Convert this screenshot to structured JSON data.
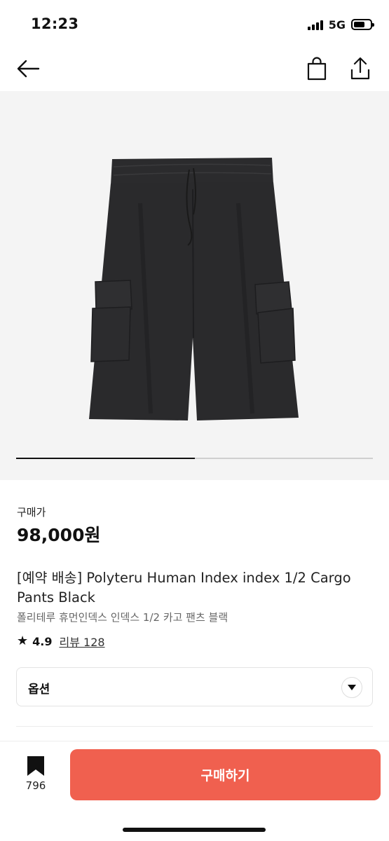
{
  "status_bar": {
    "time": "12:23",
    "network": "5G",
    "battery_level": 0.7
  },
  "nav": {
    "back_icon": "arrow-left-icon",
    "bag_icon": "shopping-bag-icon",
    "share_icon": "share-icon"
  },
  "product": {
    "image_alt": "black cargo shorts",
    "carousel_progress": 0.5,
    "price_label": "구매가",
    "price": "98,000원",
    "title_en": "[예약 배송] Polyteru Human Index index 1/2 Cargo Pants Black",
    "title_ko": "폴리테루 휴먼인덱스 인덱스 1/2 카고 팬츠 블랙",
    "rating": "4.9",
    "review_label": "리뷰 128"
  },
  "options": {
    "label": "옵션"
  },
  "bottom_bar": {
    "bookmark_count": "796",
    "buy_label": "구매하기",
    "buy_color": "#f0604f"
  }
}
